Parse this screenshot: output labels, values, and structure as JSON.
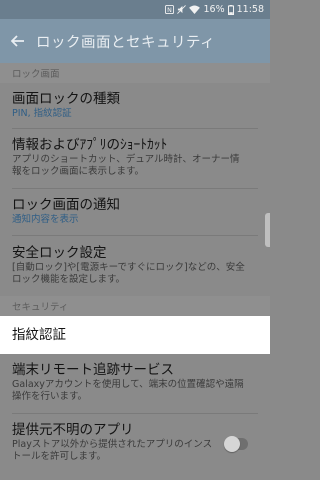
{
  "status": {
    "battery": "16%",
    "time": "11:58"
  },
  "appbar": {
    "title": "ロック画面とセキュリティ"
  },
  "sections": [
    {
      "header": "ロック画面"
    },
    {
      "header": "セキュリティ"
    }
  ],
  "items": [
    {
      "title": "画面ロックの種類",
      "subtitle": "PIN, 指紋認証"
    },
    {
      "title": "情報およびｱﾌﾟﾘのｼｮｰﾄｶｯﾄ",
      "subtitle": "アプリのショートカット、デュアル時計、オーナー情報をロック画面に表示します。"
    },
    {
      "title": "ロック画面の通知",
      "subtitle": "通知内容を表示"
    },
    {
      "title": "安全ロック設定",
      "subtitle": "[自動ロック]や[電源キーですぐにロック]などの、安全ロック機能を設定します。"
    },
    {
      "title": "指紋認証"
    },
    {
      "title": "端末リモート追跡サービス",
      "subtitle": "Galaxyアカウントを使用して、端末の位置確認や遠隔操作を行います。"
    },
    {
      "title": "提供元不明のアプリ",
      "subtitle": "Playストア以外から提供されたアプリのインストールを許可します。",
      "toggle": false
    }
  ],
  "colors": {
    "statusbar": "#6a7e8e",
    "appbar": "#7f96a8",
    "accent": "#2f5e86"
  }
}
